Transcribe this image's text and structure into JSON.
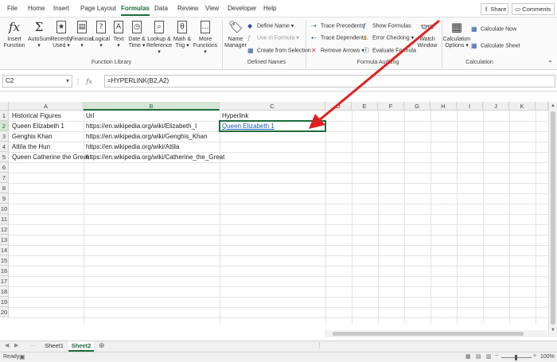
{
  "tabs": [
    "File",
    "Home",
    "Insert",
    "Page Layout",
    "Formulas",
    "Data",
    "Review",
    "View",
    "Developer",
    "Help"
  ],
  "top_buttons": {
    "share": "Share",
    "comments": "Comments"
  },
  "ribbon": {
    "function_library": {
      "label": "Function Library",
      "buttons": [
        {
          "top": "Insert",
          "bottom": "Function",
          "icon": "fx-icon"
        },
        {
          "top": "AutoSum",
          "bottom": "",
          "icon": "sigma-icon"
        },
        {
          "top": "Recently",
          "bottom": "Used",
          "icon": "star-book-icon"
        },
        {
          "top": "Financial",
          "bottom": "",
          "icon": "book-icon"
        },
        {
          "top": "Logical",
          "bottom": "",
          "icon": "book-icon"
        },
        {
          "top": "Text",
          "bottom": "",
          "icon": "text-book-icon"
        },
        {
          "top": "Date &",
          "bottom": "Time",
          "icon": "clock-book-icon"
        },
        {
          "top": "Lookup &",
          "bottom": "Reference",
          "icon": "book-icon"
        },
        {
          "top": "Math &",
          "bottom": "Trig",
          "icon": "theta-book-icon"
        },
        {
          "top": "More",
          "bottom": "Functions",
          "icon": "book-icon"
        }
      ]
    },
    "defined_names": {
      "label": "Defined Names",
      "name_manager_top": "Name",
      "name_manager_bottom": "Manager",
      "define_name": "Define Name",
      "use_in_formula": "Use in Formula",
      "create_from_selection": "Create from Selection"
    },
    "formula_auditing": {
      "label": "Formula Auditing",
      "trace_precedents": "Trace Precedents",
      "trace_dependents": "Trace Dependents",
      "remove_arrows": "Remove Arrows",
      "show_formulas": "Show Formulas",
      "error_checking": "Error Checking",
      "evaluate_formula": "Evaluate Formula",
      "watch_window_top": "Watch",
      "watch_window_bottom": "Window"
    },
    "calculation": {
      "label": "Calculation",
      "options_top": "Calculation",
      "options_bottom": "Options",
      "calculate_now": "Calculate Now",
      "calculate_sheet": "Calculate Sheet"
    }
  },
  "formula_bar": {
    "name_box": "C2",
    "fx": "fx",
    "formula": "=HYPERLINK(B2,A2)"
  },
  "columns": [
    "A",
    "B",
    "C",
    "D",
    "E",
    "F",
    "G",
    "H",
    "I",
    "J",
    "K"
  ],
  "rows": [
    "1",
    "2",
    "3",
    "4",
    "5",
    "6",
    "7",
    "8",
    "9",
    "10",
    "11",
    "12",
    "13",
    "14",
    "15",
    "16",
    "17",
    "18",
    "19",
    "20"
  ],
  "cells": {
    "a1": "Historical Figures",
    "b1": "Url",
    "c1": "Hyperlink",
    "a2": "Queen Elizabeth 1",
    "b2": "https://en.wikipedia.org/wiki/Elizabeth_I",
    "c2": "Queen Elizabeth 1",
    "a3": "Genghis Khan",
    "b3": "https://en.wikipedia.org/wiki/Genghis_Khan",
    "a4": "Attila the Hun",
    "b4": "https://en.wikipedia.org/wiki/Attila",
    "a5": "Queen Catherine the Great",
    "b5": "https://en.wikipedia.org/wiki/Catherine_the_Great"
  },
  "sheets": [
    "Sheet1",
    "Sheet2"
  ],
  "active_sheet": "Sheet2",
  "status": {
    "ready": "Ready",
    "zoom": "100%"
  },
  "colors": {
    "accent": "#1e6b3c",
    "link": "#1a5fb4",
    "arrow": "#e02020"
  }
}
